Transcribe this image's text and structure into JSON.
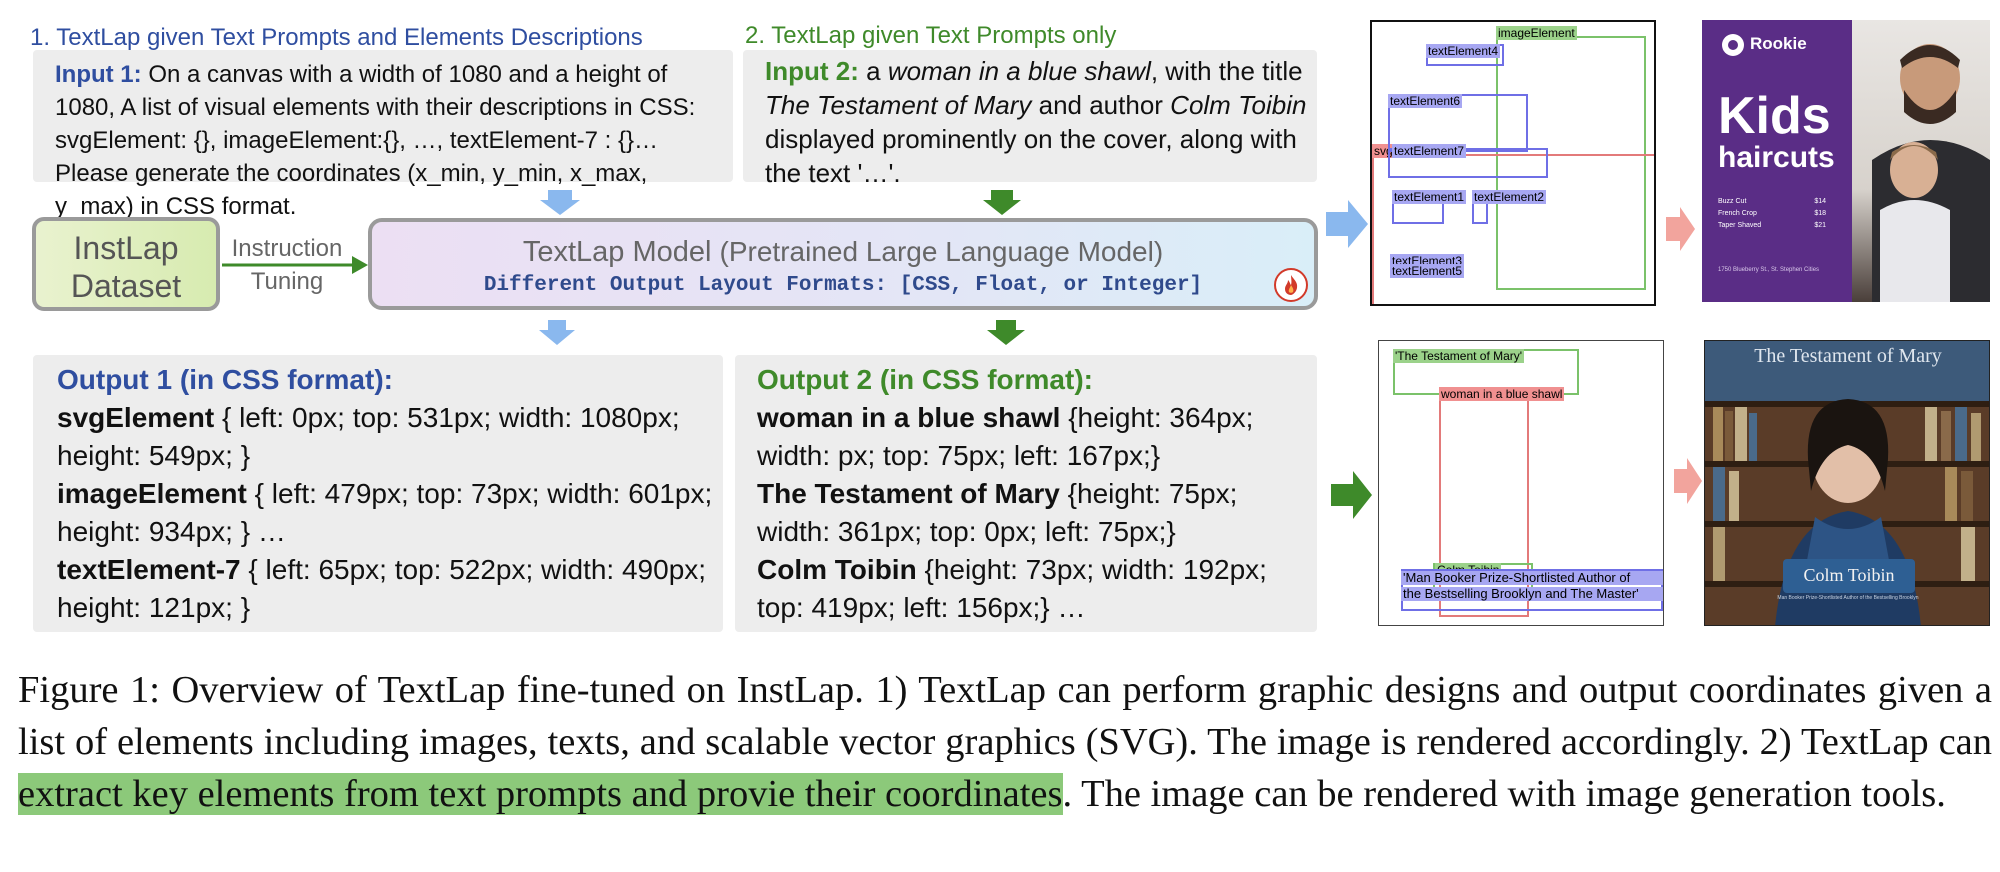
{
  "col1": {
    "header": "1. TextLap given Text Prompts and Elements Descriptions",
    "input_label": "Input 1:",
    "input_text": "On a canvas with a width of 1080 and a height of 1080, A list of visual elements with their descriptions in CSS: svgElement: {}, imageElement:{}, …, textElement-7 : {}…Please generate the coordinates (x_min, y_min, x_max, y_max) in CSS format."
  },
  "col2": {
    "header": "2. TextLap given Text Prompts only",
    "input_label": "Input 2:",
    "input_pre": "a",
    "input_it1": "woman in a blue shawl",
    "input_mid1": ", with the title",
    "input_it2": "The Testament of Mary",
    "input_mid2": "and author",
    "input_it3": "Colm Toibin",
    "input_post": "displayed prominently on the cover, along with the text '…'."
  },
  "dataset": {
    "line1": "InstLap",
    "line2": "Dataset"
  },
  "instruction": {
    "line1": "Instruction",
    "line2": "Tuning"
  },
  "model": {
    "name": "TextLap Model",
    "paren": "(Pretrained Large Language Model)",
    "formats": "Different Output Layout Formats: [CSS, Float, or Integer]"
  },
  "output1": {
    "title": "Output 1 (in CSS format):",
    "rows": [
      {
        "name": "svgElement",
        "text": "{ left: 0px; top: 531px; width: 1080px;"
      },
      {
        "name": "",
        "text": "height: 549px; }"
      },
      {
        "name": "imageElement",
        "text": "{ left: 479px; top: 73px; width: 601px;"
      },
      {
        "name": "",
        "text": "height: 934px; } …"
      },
      {
        "name": "textElement-7",
        "text": "{ left: 65px; top: 522px; width: 490px;"
      },
      {
        "name": "",
        "text": "height: 121px; }"
      }
    ]
  },
  "output2": {
    "title": "Output 2 (in CSS format):",
    "rows": [
      {
        "name": "woman in a blue shawl",
        "text": "{height: 364px;"
      },
      {
        "name": "",
        "text": "width: px; top: 75px; left: 167px;}"
      },
      {
        "name": "The Testament of Mary",
        "text": "{height: 75px;"
      },
      {
        "name": "",
        "text": "width: 361px; top: 0px; left: 75px;}"
      },
      {
        "name": "Colm Toibin",
        "text": "{height: 73px; width: 192px;"
      },
      {
        "name": "",
        "text": "top: 419px; left: 156px;} …"
      }
    ]
  },
  "layout1_labels": {
    "image": "imageElement",
    "t4": "textElement4",
    "t6": "textElement6",
    "svg": "svgElement",
    "t7": "textElement7",
    "t1": "textElement1",
    "t2": "textElement2",
    "t3": "textElement3",
    "t5": "textElement5"
  },
  "poster1": {
    "brand": "Rookie",
    "title1": "Kids",
    "title2": "haircuts",
    "prices": [
      {
        "item": "Buzz Cut",
        "price": "$14"
      },
      {
        "item": "French Crop",
        "price": "$18"
      },
      {
        "item": "Taper Shaved",
        "price": "$21"
      }
    ],
    "footer": "1750 Blueberry St., St. Stephen Cities"
  },
  "layout2_labels": {
    "title": "'The Testament of Mary'",
    "woman": "woman in a blue shawl",
    "author": "Colm Toibin",
    "blurb1": "'Man Booker Prize-Shortlisted Author of",
    "blurb2": "the Bestselling Brooklyn and The Master'"
  },
  "poster2": {
    "title": "The Testament of Mary",
    "author": "Colm Toibin",
    "small": "Man Booker Prize-Shortlisted Author of the Bestselling Brooklyn"
  },
  "caption": {
    "p1": "Figure 1:  Overview of TextLap fine-tuned on InstLap.  1) TextLap can perform graphic designs and output coordinates given a list of elements including images, texts, and scalable vector graphics (SVG). The image is rendered accordingly. 2) TextLap can ",
    "highlight": "extract key elements from text prompts and provie their coordinates",
    "p2": ". The image can be rendered with image generation tools."
  },
  "colors": {
    "panel": "#ededed",
    "blue_text": "#2f4ea0",
    "green_text": "#3f8a2a",
    "arrow_blue": "#8ab8ee",
    "arrow_green": "#3e8a2a",
    "arrow_pink": "#f2a49d",
    "highlight": "#8cc97a",
    "poster_purple": "#5a2d86"
  }
}
